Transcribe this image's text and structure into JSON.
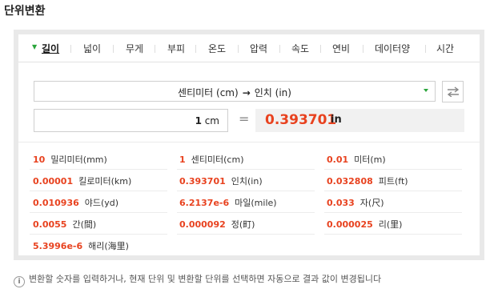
{
  "title": "단위변환",
  "tabs": [
    {
      "label": "길이",
      "active": true
    },
    {
      "label": "넓이"
    },
    {
      "label": "무게"
    },
    {
      "label": "부피"
    },
    {
      "label": "온도"
    },
    {
      "label": "압력"
    },
    {
      "label": "속도"
    },
    {
      "label": "연비"
    },
    {
      "label": "데이터양"
    },
    {
      "label": "시간"
    }
  ],
  "converter": {
    "from_unit": "센티미터 (cm)",
    "arrow": "→",
    "to_unit": "인치 (in)",
    "input_value": "1",
    "input_unit": "cm",
    "equals": "=",
    "result_value": "0.393701",
    "result_unit": "in"
  },
  "results": [
    {
      "value": "10",
      "name": "밀리미터(mm)"
    },
    {
      "value": "1",
      "name": "센티미터(cm)"
    },
    {
      "value": "0.01",
      "name": "미터(m)"
    },
    {
      "value": "0.00001",
      "name": "킬로미터(km)"
    },
    {
      "value": "0.393701",
      "name": "인치(in)"
    },
    {
      "value": "0.032808",
      "name": "피트(ft)"
    },
    {
      "value": "0.010936",
      "name": "야드(yd)"
    },
    {
      "value": "6.2137e-6",
      "name": "마일(mile)"
    },
    {
      "value": "0.033",
      "name": "자(尺)"
    },
    {
      "value": "0.0055",
      "name": "간(間)"
    },
    {
      "value": "0.000092",
      "name": "정(町)"
    },
    {
      "value": "0.000025",
      "name": "리(里)"
    },
    {
      "value": "5.3996e-6",
      "name": "해리(海里)"
    }
  ],
  "note": "변환할 숫자를 입력하거나, 현재 단위 및 변환할 단위를 선택하면 자동으로 결과 값이 변경됩니다",
  "colors": {
    "accent": "#e8421f",
    "tab_marker": "#2aa53b"
  }
}
